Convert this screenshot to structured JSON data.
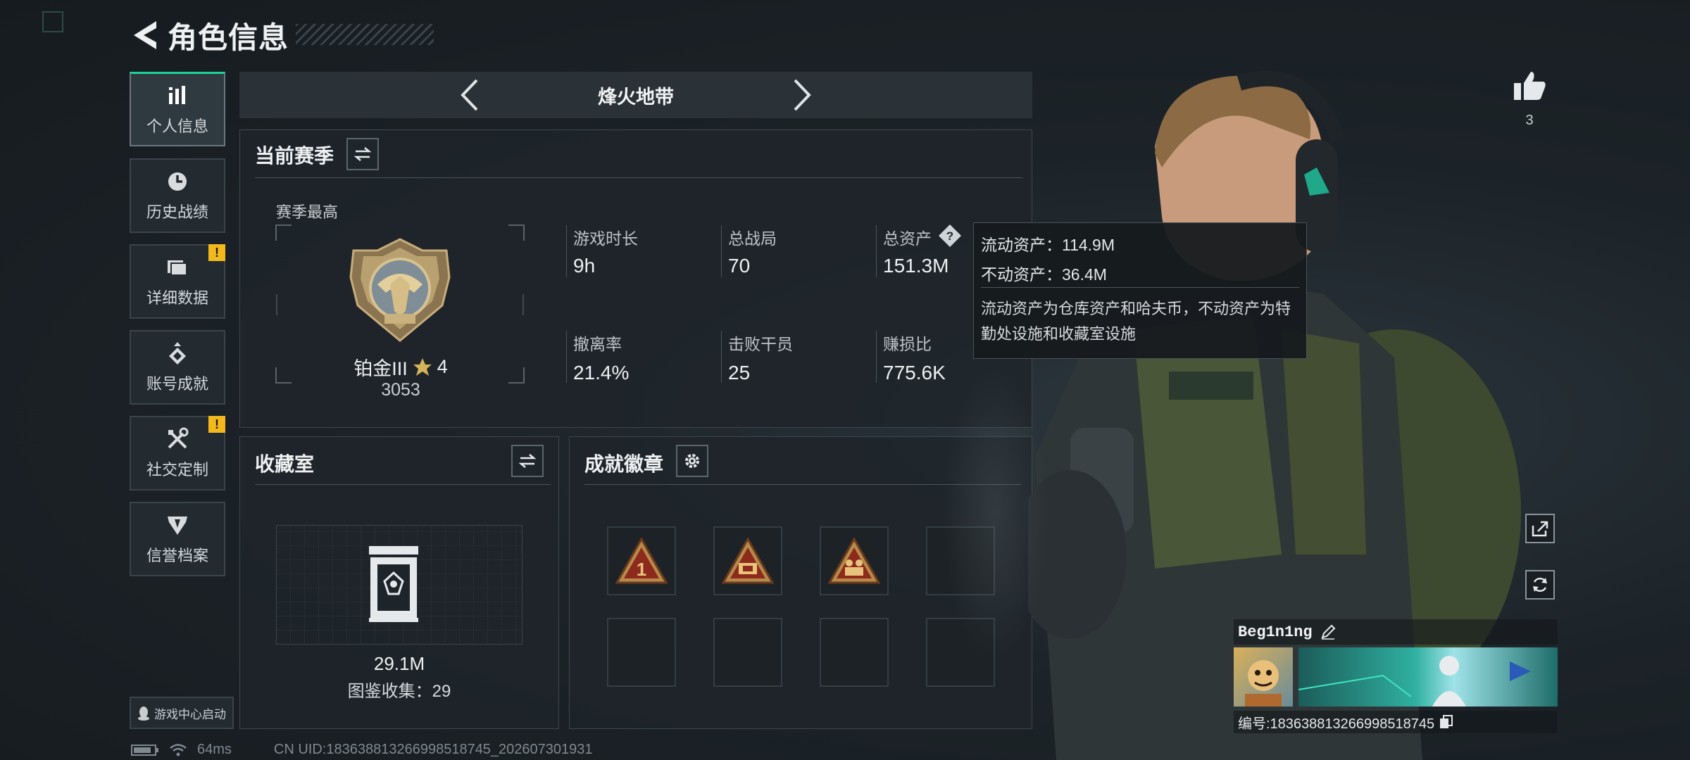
{
  "header": {
    "title": "角色信息"
  },
  "sidebar": {
    "items": [
      {
        "label": "个人信息",
        "icon": "bar-chart-icon",
        "active": true
      },
      {
        "label": "历史战绩",
        "icon": "clock-icon"
      },
      {
        "label": "详细数据",
        "icon": "folder-icon",
        "alert": "!"
      },
      {
        "label": "账号成就",
        "icon": "achievement-icon"
      },
      {
        "label": "社交定制",
        "icon": "tools-icon",
        "alert": "!"
      },
      {
        "label": "信誉档案",
        "icon": "shield-icon"
      }
    ],
    "game_center": "游戏中心启动"
  },
  "mode": {
    "name": "烽火地带"
  },
  "season": {
    "title": "当前赛季",
    "best_label": "赛季最高",
    "rank_name": "铂金III",
    "rank_stars": "4",
    "rank_score": "3053",
    "stats": [
      {
        "label": "游戏时长",
        "value": "9h"
      },
      {
        "label": "总战局",
        "value": "70"
      },
      {
        "label": "总资产",
        "value": "151.3M"
      },
      {
        "label": "撤离率",
        "value": "21.4%"
      },
      {
        "label": "击败干员",
        "value": "25"
      },
      {
        "label": "赚损比",
        "value": "775.6K"
      }
    ]
  },
  "tooltip": {
    "liquid": "流动资产：114.9M",
    "fixed": "不动资产：36.4M",
    "desc": "流动资产为仓库资产和哈夫币，不动资产为特勤处设施和收藏室设施"
  },
  "collection": {
    "title": "收藏室",
    "value": "29.1M",
    "catalog": "图鉴收集：29"
  },
  "badges": {
    "title": "成就徽章"
  },
  "likes": {
    "count": "3"
  },
  "player": {
    "name": "Beg1n1ng",
    "id": "编号:18363881326699851874​5"
  },
  "status": {
    "ping": "64ms",
    "uid": "CN UID:18363881326699851874​5_202607301931"
  },
  "colors": {
    "accent": "#19d39b",
    "warning": "#f2b81c",
    "panel": "#1e252a"
  }
}
